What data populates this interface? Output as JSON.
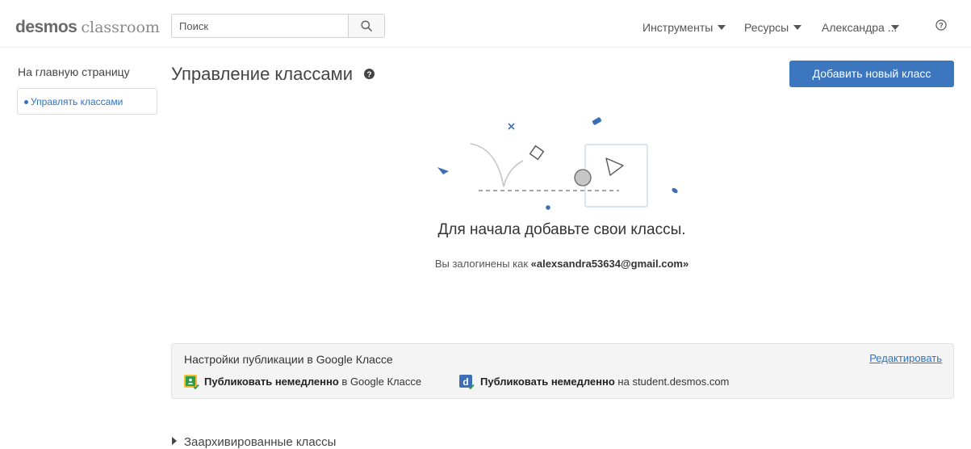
{
  "header": {
    "logo_primary": "desmos",
    "logo_secondary": "classroom",
    "search_placeholder": "Поиск",
    "nav_tools": "Инструменты",
    "nav_resources": "Ресурсы",
    "user_name": "Александра ..."
  },
  "sidebar": {
    "home": "На главную страницу",
    "items": [
      {
        "label": "Управлять классами"
      }
    ]
  },
  "main": {
    "title": "Управление классами",
    "add_button": "Добавить новый класс",
    "empty_title": "Для начала добавьте свои классы.",
    "login_prefix": "Вы залогинены как ",
    "login_email": "«alexsandra53634@gmail.com»"
  },
  "google_panel": {
    "title": "Настройки публикации в Google Классе",
    "edit": "Редактировать",
    "gc_bold": "Публиковать немедленно",
    "gc_rest": " в Google Классе",
    "desmos_bold": "Публиковать немедленно",
    "desmos_rest": " на student.desmos.com"
  },
  "archived": "Заархивированные классы",
  "colors": {
    "accent": "#3b76bf",
    "link": "#2f73c5",
    "google_classroom_green": "#2e9a4e",
    "google_classroom_yellow": "#f3c02b"
  },
  "icons": [
    "search-icon",
    "help-circle-icon",
    "question-icon",
    "google-classroom-icon",
    "desmos-d-icon",
    "check-icon",
    "chevron-down-icon",
    "triangle-right-icon"
  ]
}
